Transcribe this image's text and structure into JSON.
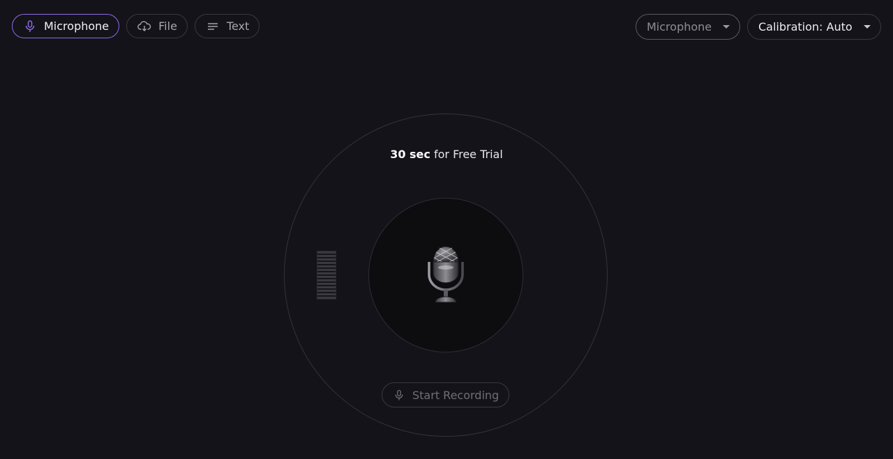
{
  "tabs": [
    {
      "label": "Microphone",
      "icon": "microphone-icon",
      "active": true
    },
    {
      "label": "File",
      "icon": "cloud-download-icon",
      "active": false
    },
    {
      "label": "Text",
      "icon": "text-lines-icon",
      "active": false
    }
  ],
  "selects": {
    "input_device": {
      "value": "Microphone"
    },
    "calibration": {
      "value": "Calibration: Auto"
    }
  },
  "trial": {
    "duration": "30 sec",
    "suffix": " for Free Trial"
  },
  "record_button": {
    "label": "Start Recording",
    "icon": "microphone-icon"
  },
  "center_icon": "studio-microphone-icon",
  "colors": {
    "background": "#141319",
    "accent": "#8d6be8",
    "border": "#3a3940",
    "muted_text": "#6f6e78"
  }
}
